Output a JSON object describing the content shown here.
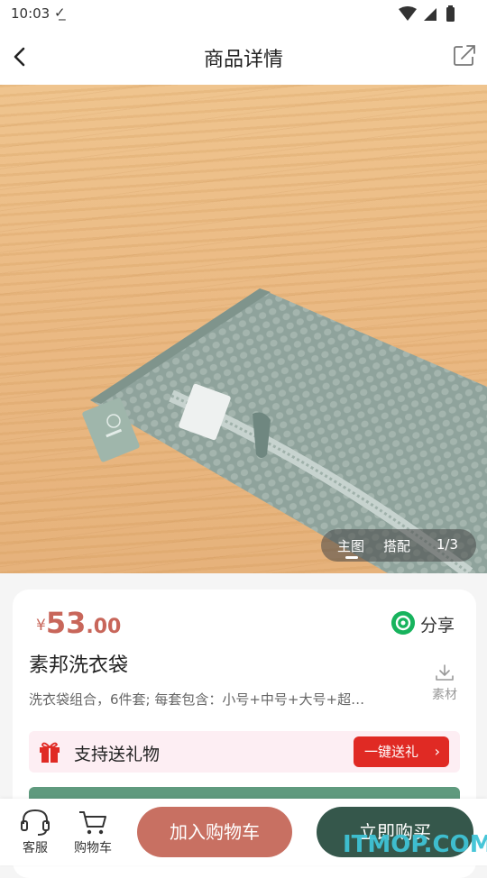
{
  "status_bar": {
    "time": "10:03"
  },
  "nav": {
    "title": "商品详情"
  },
  "gallery": {
    "tabs": [
      "主图",
      "搭配"
    ],
    "active_tab": "主图",
    "counter": "1/3"
  },
  "product": {
    "currency": "¥",
    "price_integer": "53",
    "price_decimal": ".00",
    "share_label": "分享",
    "name": "素邦洗衣袋",
    "description": "洗衣袋组合，6件套; 每套包含：小号+中号+大号+超…",
    "material_label": "素材"
  },
  "gift": {
    "label": "支持送礼物",
    "button_label": "一键送礼"
  },
  "bottom_bar": {
    "service_label": "客服",
    "cart_label": "购物车",
    "add_to_cart_label": "加入购物车",
    "buy_now_label": "立即购买"
  },
  "watermark": "ITMOP.COM",
  "colors": {
    "price": "#c8665a",
    "add_to_cart": "#c87062",
    "buy_now": "#35574b",
    "gift_button": "#e02a24",
    "share_icon": "#17b35d"
  },
  "icons": [
    "back-icon",
    "share-out-icon",
    "wechat-share-icon",
    "download-icon",
    "gift-icon",
    "headset-icon",
    "cart-icon"
  ]
}
